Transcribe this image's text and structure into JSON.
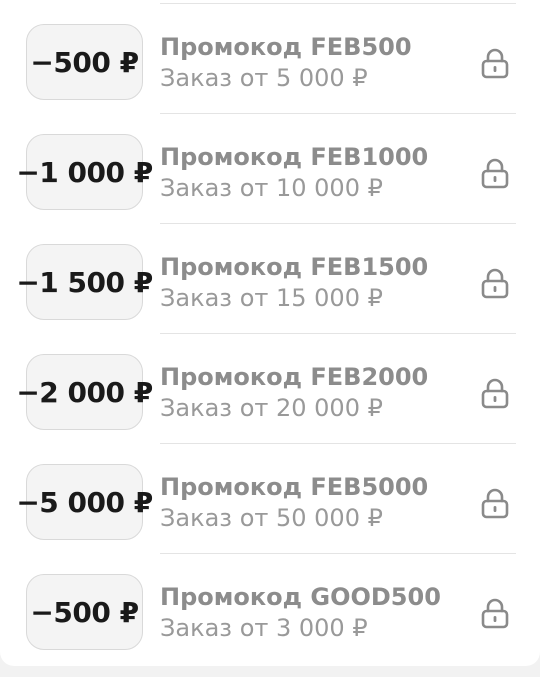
{
  "promocodes": [
    {
      "discount": "−500 ₽",
      "title": "Промокод FEB500",
      "condition": "Заказ от 5 000 ₽",
      "locked": true
    },
    {
      "discount": "−1 000 ₽",
      "title": "Промокод FEB1000",
      "condition": "Заказ от 10 000 ₽",
      "locked": true
    },
    {
      "discount": "−1 500 ₽",
      "title": "Промокод FEB1500",
      "condition": "Заказ от 15 000 ₽",
      "locked": true
    },
    {
      "discount": "−2 000 ₽",
      "title": "Промокод FEB2000",
      "condition": "Заказ от 20 000 ₽",
      "locked": true
    },
    {
      "discount": "−5 000 ₽",
      "title": "Промокод FEB5000",
      "condition": "Заказ от 50 000 ₽",
      "locked": true
    },
    {
      "discount": "−500 ₽",
      "title": "Промокод GOOD500",
      "condition": "Заказ от 3 000 ₽",
      "locked": true
    }
  ],
  "icons": {
    "lock": "lock-icon"
  },
  "colors": {
    "title": "#8c8c8c",
    "condition": "#999999",
    "badge_bg": "#f4f4f4",
    "lock": "#8a8a8a"
  }
}
